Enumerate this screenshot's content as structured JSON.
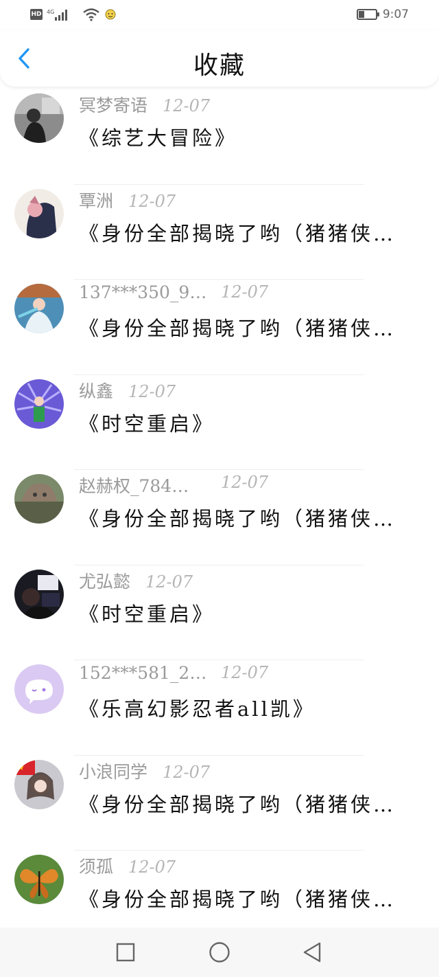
{
  "status_bar": {
    "network_badge": "HD",
    "network_type": "4G",
    "time": "9:07",
    "battery_level": 0.35
  },
  "header": {
    "title": "收藏",
    "back_icon": "chevron-left-icon",
    "accent_color": "#2196f3"
  },
  "favorites": [
    {
      "username": "冥梦寄语",
      "date": "12-07",
      "work": "《综艺大冒险》"
    },
    {
      "username": "覃洲",
      "date": "12-07",
      "work": "《身份全部揭晓了哟（猪猪侠…"
    },
    {
      "username": "137***350_9…",
      "date": "12-07",
      "work": "《身份全部揭晓了哟（猪猪侠…"
    },
    {
      "username": "纵鑫",
      "date": "12-07",
      "work": "《时空重启》"
    },
    {
      "username": "赵赫权_784…",
      "date": "12-07",
      "work": "《身份全部揭晓了哟（猪猪侠…"
    },
    {
      "username": "尤弘懿",
      "date": "12-07",
      "work": "《时空重启》"
    },
    {
      "username": "152***581_2…",
      "date": "12-07",
      "work": "《乐高幻影忍者all凯》"
    },
    {
      "username": "小浪同学",
      "date": "12-07",
      "work": "《身份全部揭晓了哟（猪猪侠…"
    },
    {
      "username": "须孤",
      "date": "12-07",
      "work": "《身份全部揭晓了哟（猪猪侠…"
    }
  ],
  "nav_bar": {
    "recents_icon": "square-icon",
    "home_icon": "circle-icon",
    "back_icon": "triangle-back-icon"
  }
}
